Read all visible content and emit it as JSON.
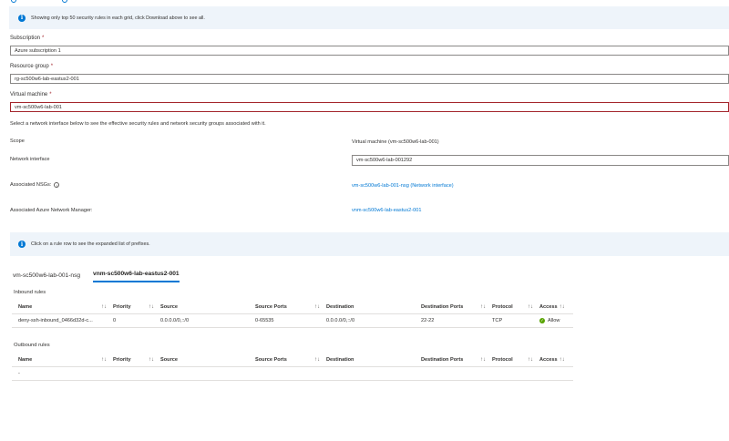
{
  "banner": {
    "text": "Showing only top 50 security rules in each grid, click Download above to see all."
  },
  "form": {
    "subscription": {
      "label": "Subscription",
      "required": "*",
      "value": "Azure subscription 1"
    },
    "resource_group": {
      "label": "Resource group",
      "required": "*",
      "value": "rg-sc500w6-lab-eastus2-001"
    },
    "virtual_machine": {
      "label": "Virtual machine",
      "required": "*",
      "value": "vm-sc500w6-lab-001"
    }
  },
  "hint": "Select a network interface below to see the effective security rules and network security groups associated with it.",
  "details": {
    "scope": {
      "label": "Scope",
      "value": "Virtual machine (vm-sc500w6-lab-001)"
    },
    "network_interface": {
      "label": "Network interface",
      "value": "vm-sc500w6-lab-001292"
    },
    "associated_nsgs": {
      "label": "Associated NSGs:",
      "value": "vm-sc500w6-lab-001-nsg (Network interface)"
    },
    "network_manager": {
      "label": "Associated Azure Network Manager:",
      "value": "vnm-sc500w6-lab-eastus2-001"
    }
  },
  "banner2": {
    "text": "Click on a rule row to see the expanded list of prefixes."
  },
  "tabs": [
    {
      "label": "vm-sc500w6-lab-001-nsg",
      "active": false
    },
    {
      "label": "vnm-sc500w6-lab-eastus2-001",
      "active": true
    }
  ],
  "columns": {
    "name": "Name",
    "priority": "Priority",
    "source": "Source",
    "source_ports": "Source Ports",
    "destination": "Destination",
    "destination_ports": "Destination Ports",
    "protocol": "Protocol",
    "access": "Access"
  },
  "sort_glyph": "↑↓",
  "inbound": {
    "title": "Inbound rules",
    "rows": [
      {
        "name": "deny-ssh-inbound_0466d32d-c...",
        "priority": "0",
        "source": "0.0.0.0/0,::/0",
        "source_ports": "0-65535",
        "destination": "0.0.0.0/0,::/0",
        "destination_ports": "22-22",
        "protocol": "TCP",
        "access": "Allow"
      }
    ]
  },
  "outbound": {
    "title": "Outbound rules",
    "rows": [
      {
        "name": "-"
      }
    ]
  },
  "colors": {
    "accent": "#0078d4",
    "banner_bg": "#eef4fa",
    "allow": "#57a300",
    "required": "#a4262c"
  }
}
